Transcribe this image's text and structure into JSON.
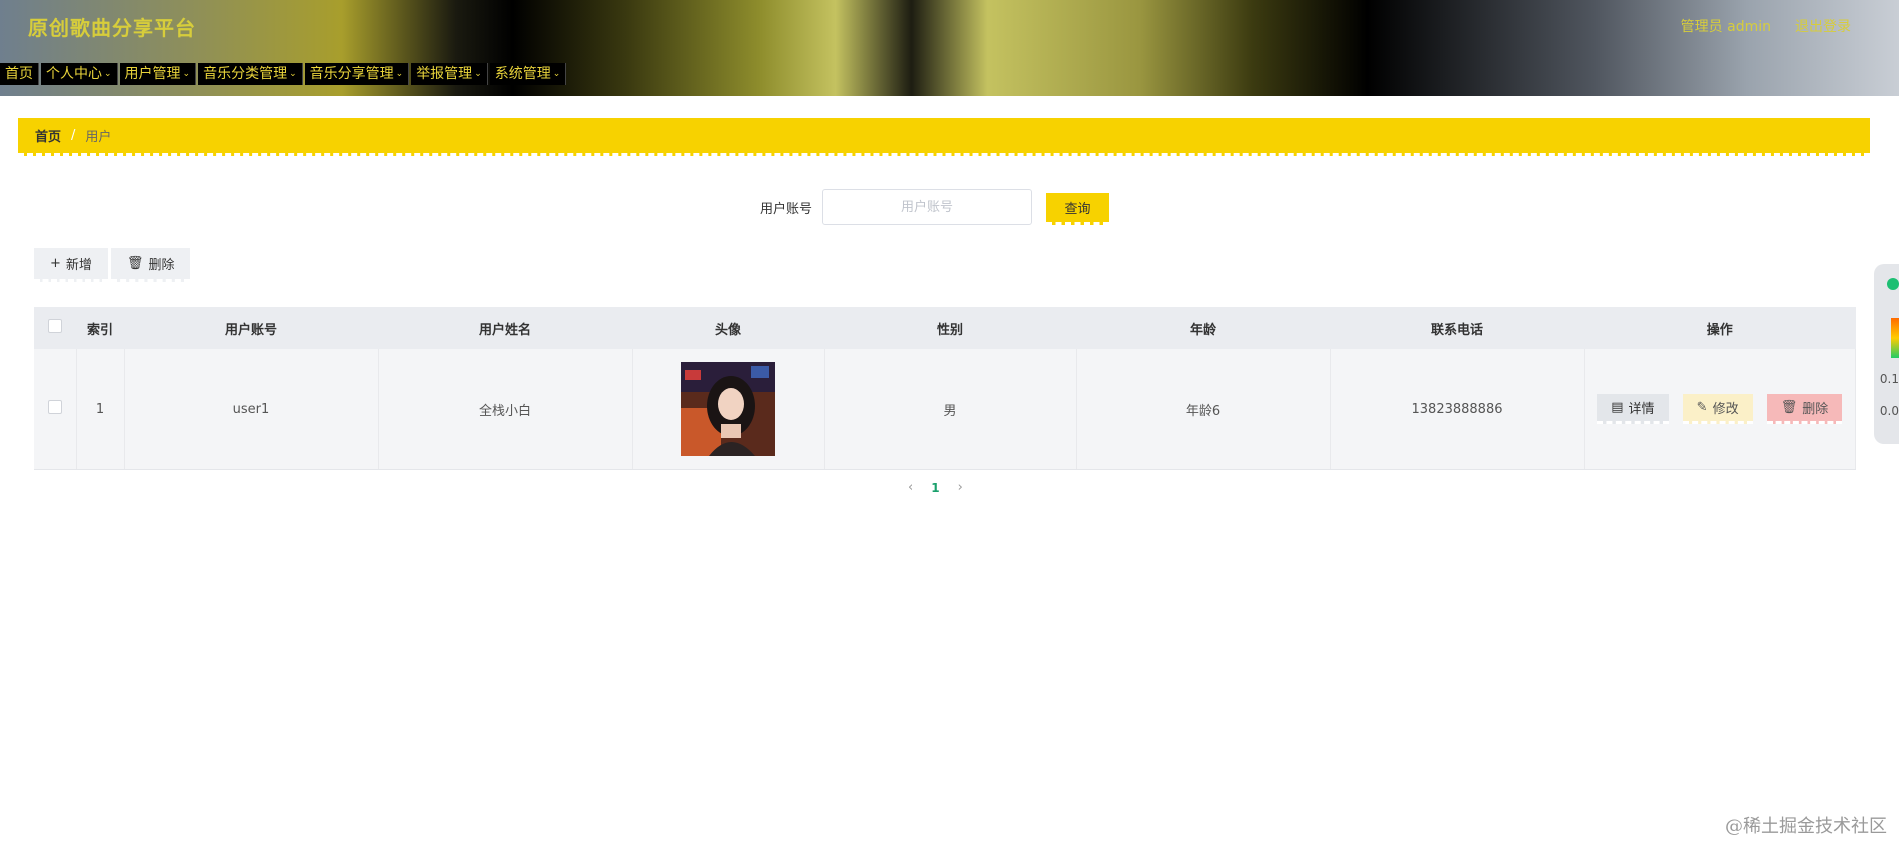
{
  "header": {
    "site_title": "原创歌曲分享平台",
    "admin_label": "管理员 admin",
    "logout_label": "退出登录"
  },
  "nav": {
    "items": [
      {
        "label": "首页",
        "has_dropdown": false
      },
      {
        "label": "个人中心",
        "has_dropdown": true
      },
      {
        "label": "用户管理",
        "has_dropdown": true
      },
      {
        "label": "音乐分类管理",
        "has_dropdown": true
      },
      {
        "label": "音乐分享管理",
        "has_dropdown": true
      },
      {
        "label": "举报管理",
        "has_dropdown": true
      },
      {
        "label": "系统管理",
        "has_dropdown": true
      }
    ]
  },
  "breadcrumb": {
    "home": "首页",
    "separator": "/",
    "current": "用户"
  },
  "search": {
    "label": "用户账号",
    "placeholder": "用户账号",
    "value": "",
    "button": "查询"
  },
  "actions": {
    "add": "新增",
    "delete": "删除"
  },
  "table": {
    "headers": [
      "索引",
      "用户账号",
      "用户姓名",
      "头像",
      "性别",
      "年龄",
      "联系电话",
      "操作"
    ],
    "rows": [
      {
        "index": "1",
        "account": "user1",
        "name": "全栈小白",
        "gender": "男",
        "age": "年龄6",
        "phone": "13823888886",
        "detail": "详情",
        "edit": "修改",
        "delete": "删除"
      }
    ]
  },
  "pager": {
    "prev": "‹",
    "current": "1",
    "next": "›"
  },
  "side_panel": {
    "top_value": "0.1",
    "bottom_value": "0.0"
  },
  "watermark": "@稀土掘金技术社区",
  "colors": {
    "accent": "#f7d200",
    "header_text": "#d7cd3b",
    "delete_button": "#f6b9b9",
    "edit_button": "#fbf0c8",
    "pager_active": "#1aa06c"
  }
}
